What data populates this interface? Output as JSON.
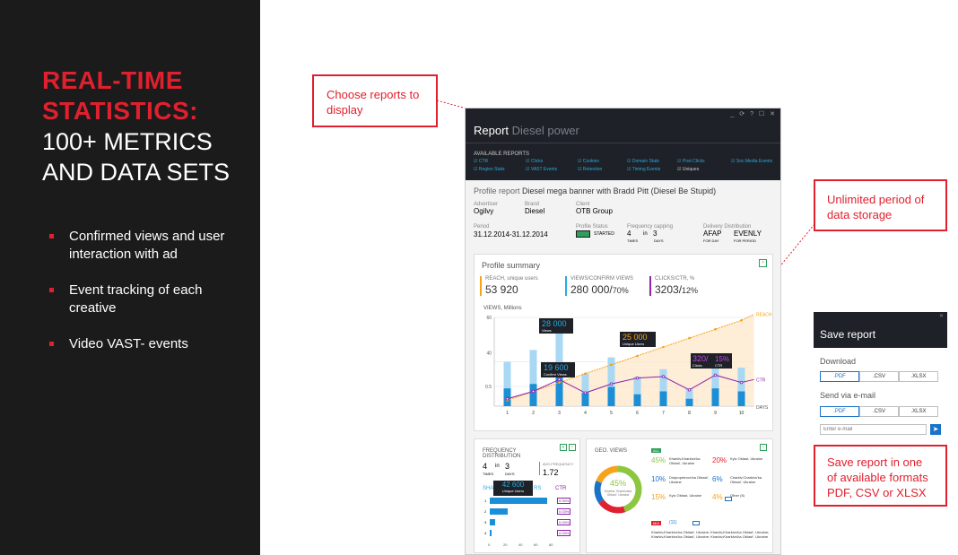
{
  "left": {
    "headline": [
      "REAL-TIME",
      "STATISTICS:"
    ],
    "sub": [
      "100+ METRICS",
      "AND DATA SETS"
    ],
    "bullets": [
      "Confirmed views and user interaction with ad",
      "Event tracking of each creative",
      "Video VAST- events"
    ]
  },
  "callouts": {
    "choose": "Choose reports to display",
    "unlimited": "Unlimited period of data storage",
    "save": "Save report in one of available formats PDF, CSV or XLSX"
  },
  "window": {
    "controls": "_ ⟳ ? ☐ ✕",
    "title": "Report",
    "campaign": "Diesel power",
    "available_label": "AVAILABLE REPORTS",
    "reports": [
      "CTR",
      "Clicks",
      "Cookies",
      "Domain Stats",
      "Post Clicks",
      "Soc.Media Events",
      "Region Stats",
      "VAST Events",
      "Retention",
      "Timing Events",
      "Uniques"
    ],
    "profile_label": "Profile report",
    "profile_name": "Diesel mega banner with Bradd Pitt (Diesel Be Stupid)",
    "advertiser_label": "Advertiser",
    "advertiser": "Ogilvy",
    "brand_label": "Brand",
    "brand": "Diesel",
    "client_label": "Client",
    "client": "OTB Group",
    "period_label": "Period",
    "period": "31.12.2014-31.12.2014",
    "status_label": "Profile Status",
    "status": "STARTED",
    "freq_label": "Frequency capping",
    "freq_times": "4",
    "freq_in": "in",
    "freq_days": "3",
    "times": "TIMES",
    "days": "DAYS",
    "dist_label": "Delivery Distribution",
    "dist_day": "AFAP",
    "dist_period": "EVENLY",
    "for_day": "FOR DAY",
    "for_period": "FOR PERIOD",
    "summary_title": "Profile summary",
    "reach_label": "REACH, unique users",
    "reach": "53 920",
    "views_label": "VIEWS/CONFIRM VIEWS",
    "views": "280 000/",
    "views_pct": "70%",
    "clicks_label": "CLICKS/CTR, %",
    "clicks": "3203/",
    "clicks_pct": "12%",
    "freq_title": "FREQUENCY DISTRIBUTION",
    "avg_label": "AVG.FREQUENCY",
    "avg": "1.72",
    "share_label": "SHA",
    "share_label2": "RS",
    "ctr_label": "CTR",
    "ctr_values": [
      "0.05%",
      "0.03%",
      "0.03%",
      "0.03%"
    ],
    "freq_rows": [
      "1",
      "2",
      "3",
      "4"
    ],
    "freq_ticks": [
      "0",
      "20",
      "40",
      "60",
      "80"
    ],
    "freq_tip": "42 600",
    "freq_tip_label": "Unique Users",
    "geo_title": "GEO. VIEWS",
    "geo_badge": "ALL",
    "donut_pct": "45%",
    "donut_lbl": "Kharkiv, Kharkivska Oblast', Ukraine",
    "geo": [
      {
        "pct": "45%",
        "name": "Kharkiv,Kharkivs'ka Oblast', Ukraine",
        "color": "#8dc63f"
      },
      {
        "pct": "20%",
        "name": "Kyiv Oblast, Ukraine",
        "color": "#e0202e"
      },
      {
        "pct": "10%",
        "name": "Dnipropetrovs'ka Oblast', Ukraine",
        "color": "#1a73c8"
      },
      {
        "pct": "6%",
        "name": "Charkiv,Charkivs'ka Oblast', Ukraine",
        "color": "#1a73c8"
      },
      {
        "pct": "15%",
        "name": "Kyiv Oblast, Ukraine",
        "color": "#f7a21b"
      },
      {
        "pct": "4%",
        "name": "Other",
        "color": "#f7a21b"
      }
    ],
    "other_count": "(5)",
    "geo_badge2": "MIX",
    "geo_count": "(11)",
    "geo_list": "Kharkiv,Kharkivs'ka Oblast', Ukraine; Kharkiv,Kharkivs'ka Oblast', Ukraine; Kharkiv,Kharkivs'ka Oblast', Ukraine; Kharkiv,Kharkivs'ka Oblast', Ukraine"
  },
  "chart_data": {
    "type": "bar",
    "ylabel": "VIEWS, Millions",
    "xlabel": "DAYS",
    "categories": [
      "1",
      "2",
      "3",
      "4",
      "5",
      "6",
      "7",
      "8",
      "9",
      "10"
    ],
    "yticks": [
      "0.5",
      "40",
      "60"
    ],
    "series": [
      {
        "name": "",
        "values": [
          30,
          38,
          55,
          22,
          33,
          20,
          25,
          12,
          30,
          26
        ]
      },
      {
        "name": "",
        "values": [
          12,
          15,
          22,
          9,
          13,
          8,
          10,
          5,
          12,
          10
        ]
      }
    ],
    "lines": [
      {
        "name": "REACH",
        "color": "#f7a21b",
        "values": [
          4,
          10,
          16,
          22,
          28,
          34,
          40,
          46,
          52,
          58
        ]
      },
      {
        "name": "CTR",
        "color": "#8e24aa",
        "values": [
          5,
          10,
          18,
          9,
          15,
          19,
          20,
          11,
          21,
          16
        ]
      }
    ],
    "tooltips": [
      {
        "value": "28 000",
        "label": "Views"
      },
      {
        "value": "19 600",
        "label": "Confirm Views"
      },
      {
        "value": "25 000",
        "label": "Unique Users"
      },
      {
        "value": "320/",
        "value2": "15%",
        "label": "Clicks",
        "label2": "CTR"
      }
    ]
  },
  "save": {
    "title": "Save report",
    "close": "✕",
    "download": "Download",
    "email_label": "Send via e-mail",
    "formats": [
      ".PDF",
      ".CSV",
      ".XLSX"
    ],
    "placeholder": "Enter e-mail"
  }
}
